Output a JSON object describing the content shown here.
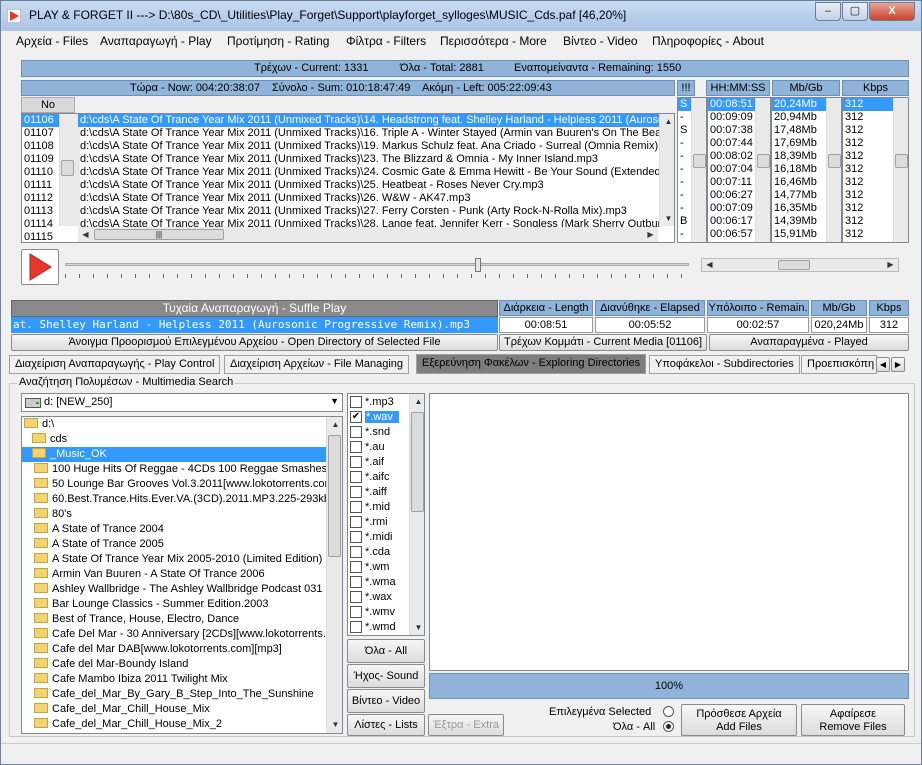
{
  "window": {
    "title": "PLAY & FORGET II ---> D:\\80s_CD\\_Utilities\\Play_Forget\\Support\\playforget_sylloges\\MUSIC_Cds.paf [46,20%]",
    "min": "–",
    "max": "▢",
    "close": "X"
  },
  "menu": [
    "Αρχεία - Files",
    "Αναπαραγωγή - Play",
    "Προτίμηση - Rating",
    "Φίλτρα - Filters",
    "Περισσότερα - More",
    "Βίντεο - Video",
    "Πληροφορίες - About"
  ],
  "stats": {
    "current": "Τρέχων - Current: 1331",
    "total": "Όλα - Total: 2881",
    "remaining": "Εναπομείναντα - Remaining: 1550",
    "now": "Τώρα - Now:  004:20:38:07",
    "sum": "Σύνολο - Sum:  010:18:47:49",
    "left": "Ακόμη - Left:   005:22:09:43"
  },
  "playlist": {
    "col_no": "No",
    "col_flag": "!!!",
    "col_time": "HH:MM:SS",
    "col_size": "Mb/Gb",
    "col_kbps": "Kbps",
    "rows": [
      {
        "no": "01106",
        "path": "d:\\cds\\A State Of Trance Year Mix 2011 (Unmixed Tracks)\\14. Headstrong feat. Shelley Harland - Helpless 2011 (Aurosonic",
        "flag": "S",
        "time": "00:08:51",
        "size": "20,24Mb",
        "kbps": "312"
      },
      {
        "no": "01107",
        "path": "d:\\cds\\A State Of Trance Year Mix 2011 (Unmixed Tracks)\\16. Triple A - Winter Stayed (Armin van Buuren's On The Beach",
        "flag": "-",
        "time": "00:09:09",
        "size": "20,94Mb",
        "kbps": "312"
      },
      {
        "no": "01108",
        "path": "d:\\cds\\A State Of Trance Year Mix 2011 (Unmixed Tracks)\\19. Markus Schulz feat. Ana Criado - Surreal (Omnia Remix).mp",
        "flag": "S",
        "time": "00:07:38",
        "size": "17,48Mb",
        "kbps": "312"
      },
      {
        "no": "01109",
        "path": "d:\\cds\\A State Of Trance Year Mix 2011 (Unmixed Tracks)\\23. The Blizzard & Omnia - My Inner Island.mp3",
        "flag": "-",
        "time": "00:07:44",
        "size": "17,69Mb",
        "kbps": "312"
      },
      {
        "no": "01110",
        "path": "d:\\cds\\A State Of Trance Year Mix 2011 (Unmixed Tracks)\\24. Cosmic Gate & Emma Hewitt - Be Your Sound (Extended M",
        "flag": "-",
        "time": "00:08:02",
        "size": "18,39Mb",
        "kbps": "312"
      },
      {
        "no": "01111",
        "path": "d:\\cds\\A State Of Trance Year Mix 2011 (Unmixed Tracks)\\25. Heatbeat - Roses Never Cry.mp3",
        "flag": "-",
        "time": "00:07:04",
        "size": "16,18Mb",
        "kbps": "312"
      },
      {
        "no": "01112",
        "path": "d:\\cds\\A State Of Trance Year Mix 2011 (Unmixed Tracks)\\26. W&W - AK47.mp3",
        "flag": "-",
        "time": "00:07:11",
        "size": "16,46Mb",
        "kbps": "312"
      },
      {
        "no": "01113",
        "path": "d:\\cds\\A State Of Trance Year Mix 2011 (Unmixed Tracks)\\27. Ferry Corsten - Punk (Arty Rock-N-Rolla Mix).mp3",
        "flag": "-",
        "time": "00:06:27",
        "size": "14,77Mb",
        "kbps": "312"
      },
      {
        "no": "01114",
        "path": "d:\\cds\\A State Of Trance Year Mix 2011 (Unmixed Tracks)\\28. Lange feat. Jennifer Kerr - Songless (Mark Sherry Outburst",
        "flag": "-",
        "time": "00:07:09",
        "size": "16,35Mb",
        "kbps": "312"
      },
      {
        "no": "01115",
        "path": "",
        "flag": "B",
        "time": "00:06:17",
        "size": "14,39Mb",
        "kbps": "312"
      },
      {
        "no": "",
        "path": "",
        "flag": "-",
        "time": "00:06:57",
        "size": "15,91Mb",
        "kbps": "312"
      }
    ],
    "hscroll_grip": "|||"
  },
  "player": {
    "mode": "Τυχαία Αναπαραγωγή - Suffle Play",
    "now_playing": "at. Shelley Harland - Helpless 2011 (Aurosonic Progressive Remix).mp3",
    "h_length": "Διάρκεια - Length",
    "h_elapsed": "Διανύθηκε - Elapsed",
    "h_remain": "Υπόλοιπο - Remain.",
    "h_size": "Mb/Gb",
    "h_kbps": "Kbps",
    "length": "00:08:51",
    "elapsed": "00:05:52",
    "remain": "00:02:57",
    "size": "020,24Mb",
    "kbps": "312",
    "progress": 0.663,
    "open_dir": "Άνοιγμα Προορισμού Επιλεγμένου Αρχείου - Open Directory of Selected File",
    "current_media": "Τρέχων Κομμάτι - Current Media [01106]",
    "played": "Αναπαραγμένα - Played"
  },
  "tabs": [
    "Διαχείριση Αναπαραγωγής - Play Control",
    "Διαχείριση Αρχείων - File Managing",
    "Εξερεύνηση Φακέλων - Exploring  Directories",
    "Υποφάκελοι - Subdirectories",
    "Προεπισκόπη"
  ],
  "search": {
    "group": "Αναζήτηση Πολυμέσων - Multimedia Search",
    "drive": "d: [NEW_250]",
    "tree": [
      "d:\\",
      "cds",
      "_Music_OK",
      "100 Huge Hits Of Reggae - 4CDs 100 Reggae Smashes.2",
      "50 Lounge Bar Grooves Vol.3.2011[www.lokotorrents.com",
      "60.Best.Trance.Hits.Ever.VA.(3CD).2011.MP3.225-293kbp",
      "80's",
      "A State of Trance 2004",
      "A State of Trance 2005",
      "A State Of Trance Year Mix 2005-2010 (Limited Edition)",
      "Armin Van Buuren - A State Of Trance 2006",
      "Ashley Wallbridge - The Ashley Wallbridge Podcast 031 (2",
      "Bar Lounge Classics - Summer Edition.2003",
      "Best of Trance, House, Electro, Dance",
      "Cafe Del Mar - 30 Anniversary [2CDs][www.lokotorrents.cc",
      "Cafe del Mar DAB[www.lokotorrents.com][mp3]",
      "Cafe del Mar-Boundy Island",
      "Cafe Mambo Ibiza 2011 Twilight Mix",
      "Cafe_del_Mar_By_Gary_B_Step_Into_The_Sunshine",
      "Cafe_del_Mar_Chill_House_Mix",
      "Cafe_del_Mar_Chill_House_Mix_2"
    ],
    "ext": [
      {
        "e": "*.mp3",
        "c": false
      },
      {
        "e": "*.wav",
        "c": true
      },
      {
        "e": "*.snd",
        "c": false
      },
      {
        "e": "*.au",
        "c": false
      },
      {
        "e": "*.aif",
        "c": false
      },
      {
        "e": "*.aifc",
        "c": false
      },
      {
        "e": "*.aiff",
        "c": false
      },
      {
        "e": "*.mid",
        "c": false
      },
      {
        "e": "*.rmi",
        "c": false
      },
      {
        "e": "*.midi",
        "c": false
      },
      {
        "e": "*.cda",
        "c": false
      },
      {
        "e": "*.wm",
        "c": false
      },
      {
        "e": "*.wma",
        "c": false
      },
      {
        "e": "*.wax",
        "c": false
      },
      {
        "e": "*.wmv",
        "c": false
      },
      {
        "e": "*.wmd",
        "c": false
      }
    ],
    "btn_all": "Όλα - All",
    "btn_sound": "Ήχος- Sound",
    "btn_video": "Βίντεο - Video",
    "btn_lists": "Λίστες - Lists",
    "btn_extra": "Έξτρα - Extra",
    "percent": "100%",
    "selected_label": "Επιλεγμένα  Selected",
    "all_label": "Όλα - All",
    "add1": "Πρόσθεσε Αρχεία",
    "add2": "Add Files",
    "rem1": "Αφαίρεσε",
    "rem2": "Remove Files"
  },
  "colors": {
    "accent": "#3399ff",
    "header_blue": "#8fb3d9",
    "play": "#e8372a"
  }
}
